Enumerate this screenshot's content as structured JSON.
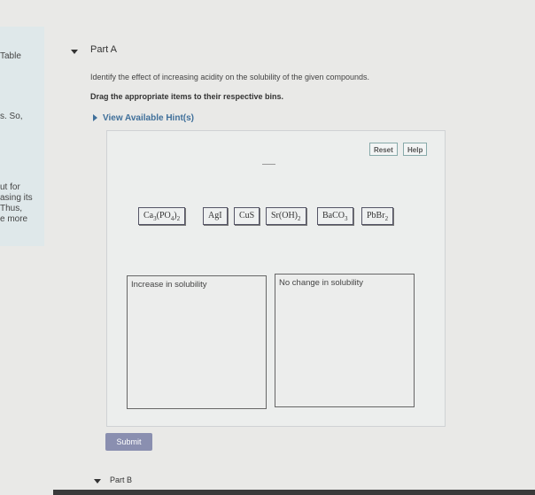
{
  "sidebar": {
    "texts": [
      "Table",
      "s. So,",
      "ut for",
      "asing its",
      "Thus,",
      "e more"
    ]
  },
  "part_a": {
    "title": "Part A",
    "instruction": "Identify the effect of increasing acidity on the solubility of the given compounds.",
    "drag_instruction": "Drag the appropriate items to their respective bins.",
    "hint_link": "View Available Hint(s)"
  },
  "toolbar": {
    "reset_label": "Reset",
    "help_label": "Help"
  },
  "items": [
    {
      "base": "Ca",
      "sub1": "3",
      "mid": "(PO",
      "sub2": "4",
      "tail": ")",
      "sub3": "2"
    },
    {
      "text": "AgI"
    },
    {
      "text": "CuS"
    },
    {
      "base": "Sr(OH)",
      "sub1": "2"
    },
    {
      "base": "BaCO",
      "sub1": "3"
    },
    {
      "base": "PbBr",
      "sub1": "2"
    }
  ],
  "bins": [
    {
      "label": "Increase in solubility"
    },
    {
      "label": "No change in solubility"
    }
  ],
  "submit_label": "Submit",
  "part_b": {
    "title": "Part B"
  }
}
